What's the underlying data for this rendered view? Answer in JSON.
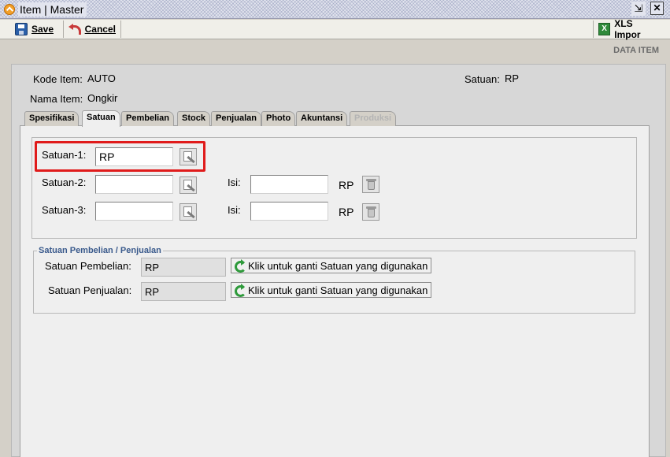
{
  "window": {
    "title": "Item | Master",
    "icons": {
      "app": "app-icon",
      "restore": "restore-icon",
      "close": "close-icon"
    }
  },
  "toolbar": {
    "save_label": "Save",
    "cancel_label": "Cancel",
    "xls_label": "XLS Impor",
    "xls_icon_text": "X"
  },
  "header": {
    "section_title": "DATA ITEM",
    "kode_item_label": "Kode Item:",
    "kode_item_value": "AUTO",
    "nama_item_label": "Nama Item:",
    "nama_item_value": "Ongkir",
    "satuan_label": "Satuan:",
    "satuan_value": "RP"
  },
  "tabs": [
    {
      "label": "Spesifikasi",
      "active": false,
      "enabled": true
    },
    {
      "label": "Satuan",
      "active": true,
      "enabled": true
    },
    {
      "label": "Pembelian",
      "active": false,
      "enabled": true
    },
    {
      "label": "Stock",
      "active": false,
      "enabled": true
    },
    {
      "label": "Penjualan",
      "active": false,
      "enabled": true
    },
    {
      "label": "Photo",
      "active": false,
      "enabled": true
    },
    {
      "label": "Akuntansi",
      "active": false,
      "enabled": true
    },
    {
      "label": "Produksi",
      "active": false,
      "enabled": false
    }
  ],
  "satuan_tab": {
    "satuan1": {
      "label": "Satuan-1:",
      "value": "RP"
    },
    "satuan2": {
      "label": "Satuan-2:",
      "value": "",
      "isi_label": "Isi:",
      "isi_value": "",
      "unit": "RP"
    },
    "satuan3": {
      "label": "Satuan-3:",
      "value": "",
      "isi_label": "Isi:",
      "isi_value": "",
      "unit": "RP"
    },
    "group_title": "Satuan Pembelian / Penjualan",
    "pembelian": {
      "label": "Satuan Pembelian:",
      "value": "RP",
      "button": "Klik untuk ganti Satuan yang digunakan"
    },
    "penjualan": {
      "label": "Satuan Penjualan:",
      "value": "RP",
      "button": "Klik untuk ganti Satuan yang digunakan"
    }
  },
  "colors": {
    "highlight": "#e01b1b",
    "group_title": "#3a5a8c"
  }
}
